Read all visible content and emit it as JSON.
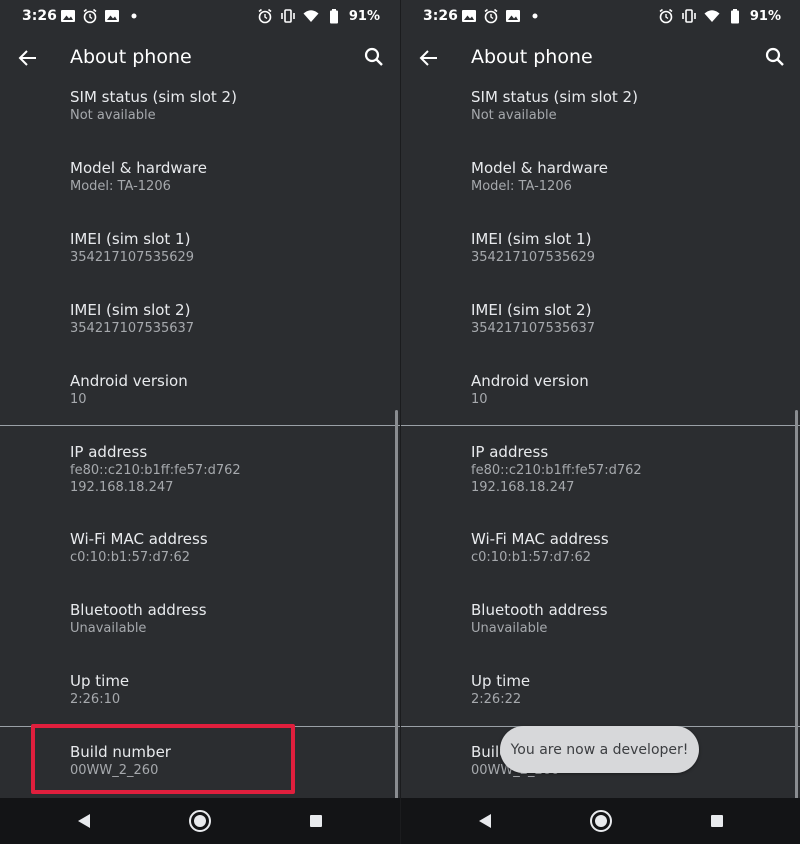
{
  "status": {
    "time": "3:26",
    "battery_pct": "91%",
    "notification_icons": [
      "gallery-icon",
      "alarm-icon",
      "gallery-icon",
      "dot-icon"
    ],
    "system_icons": [
      "alarm-icon",
      "vibrate-icon",
      "wifi-icon",
      "battery-icon"
    ]
  },
  "appbar": {
    "title": "About phone"
  },
  "left": {
    "items": [
      {
        "title": "SIM status (sim slot 2)",
        "sub": [
          "Not available"
        ]
      },
      {
        "title": "Model & hardware",
        "sub": [
          "Model: TA-1206"
        ]
      },
      {
        "title": "IMEI (sim slot 1)",
        "sub": [
          "354217107535629"
        ]
      },
      {
        "title": "IMEI (sim slot 2)",
        "sub": [
          "354217107535637"
        ]
      },
      {
        "title": "Android version",
        "sub": [
          "10"
        ]
      },
      {
        "title": "IP address",
        "sub": [
          "fe80::c210:b1ff:fe57:d762",
          "192.168.18.247"
        ]
      },
      {
        "title": "Wi-Fi MAC address",
        "sub": [
          "c0:10:b1:57:d7:62"
        ]
      },
      {
        "title": "Bluetooth address",
        "sub": [
          "Unavailable"
        ]
      },
      {
        "title": "Up time",
        "sub": [
          "2:26:10"
        ]
      },
      {
        "title": "Build number",
        "sub": [
          "00WW_2_260"
        ]
      }
    ]
  },
  "right": {
    "items": [
      {
        "title": "SIM status (sim slot 2)",
        "sub": [
          "Not available"
        ]
      },
      {
        "title": "Model & hardware",
        "sub": [
          "Model: TA-1206"
        ]
      },
      {
        "title": "IMEI (sim slot 1)",
        "sub": [
          "354217107535629"
        ]
      },
      {
        "title": "IMEI (sim slot 2)",
        "sub": [
          "354217107535637"
        ]
      },
      {
        "title": "Android version",
        "sub": [
          "10"
        ]
      },
      {
        "title": "IP address",
        "sub": [
          "fe80::c210:b1ff:fe57:d762",
          "192.168.18.247"
        ]
      },
      {
        "title": "Wi-Fi MAC address",
        "sub": [
          "c0:10:b1:57:d7:62"
        ]
      },
      {
        "title": "Bluetooth address",
        "sub": [
          "Unavailable"
        ]
      },
      {
        "title": "Up time",
        "sub": [
          "2:26:22"
        ]
      },
      {
        "title": "Build number",
        "sub": [
          "00WW_2_260"
        ]
      }
    ]
  },
  "toast": {
    "text": "You are now a developer!"
  },
  "colors": {
    "background": "#2b2d30",
    "text": "#e8eaed",
    "secondary_text": "#a6a9ad",
    "highlight": "#e01f3d",
    "toast_bg": "#d7d8da",
    "navbar": "#131416"
  },
  "navbar": {
    "icons": [
      "back-triangle-icon",
      "home-circle-icon",
      "recents-square-icon"
    ]
  }
}
